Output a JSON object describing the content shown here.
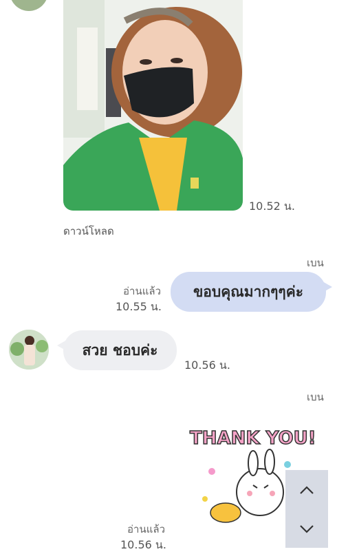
{
  "messages": {
    "photo": {
      "time": "10.52 น.",
      "download_label": "ดาวน์โหลด"
    },
    "outgoing_1": {
      "sender": "เบน",
      "read": "อ่านแล้ว",
      "time": "10.55 น.",
      "text": "ขอบคุณมากๆๆค่ะ"
    },
    "incoming_1": {
      "text": "สวย ชอบค่ะ",
      "time": "10.56 น."
    },
    "outgoing_2": {
      "sender": "เบน",
      "read": "อ่านแล้ว",
      "time": "10.56 น.",
      "sticker_text": "THANK YOU!"
    }
  },
  "scroll": {
    "up_icon": "chevron-up-icon",
    "down_icon": "chevron-down-icon"
  },
  "colors": {
    "bubble_out": "#d3dcf3",
    "bubble_in": "#eeeff2",
    "background": "#ffffff"
  }
}
